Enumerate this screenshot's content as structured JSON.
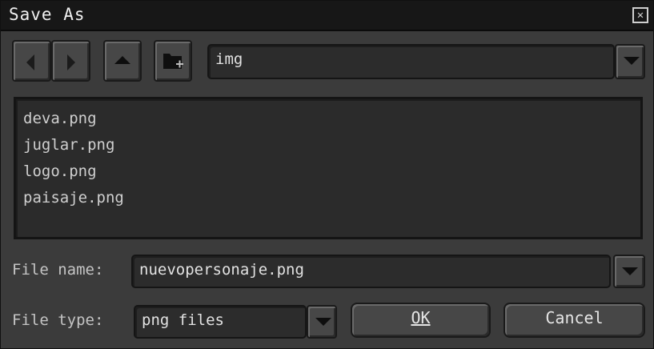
{
  "window": {
    "title": "Save As"
  },
  "toolbar": {
    "location_value": "img"
  },
  "files": [
    "deva.png",
    "juglar.png",
    "logo.png",
    "paisaje.png"
  ],
  "filename": {
    "label": "File name:",
    "value": "nuevopersonaje.png"
  },
  "filetype": {
    "label": "File type:",
    "value": "png files"
  },
  "buttons": {
    "ok": "OK",
    "cancel": "Cancel"
  },
  "icons": {
    "close": "close-icon",
    "back": "arrow-left-icon",
    "forward": "arrow-right-icon",
    "up": "arrow-up-icon",
    "new_folder": "new-folder-icon",
    "dropdown": "chevron-down-icon"
  },
  "colors": {
    "background": "#3b3b3b",
    "titlebar": "#171717",
    "field": "#2c2c2c",
    "text": "#d0d0d0"
  }
}
